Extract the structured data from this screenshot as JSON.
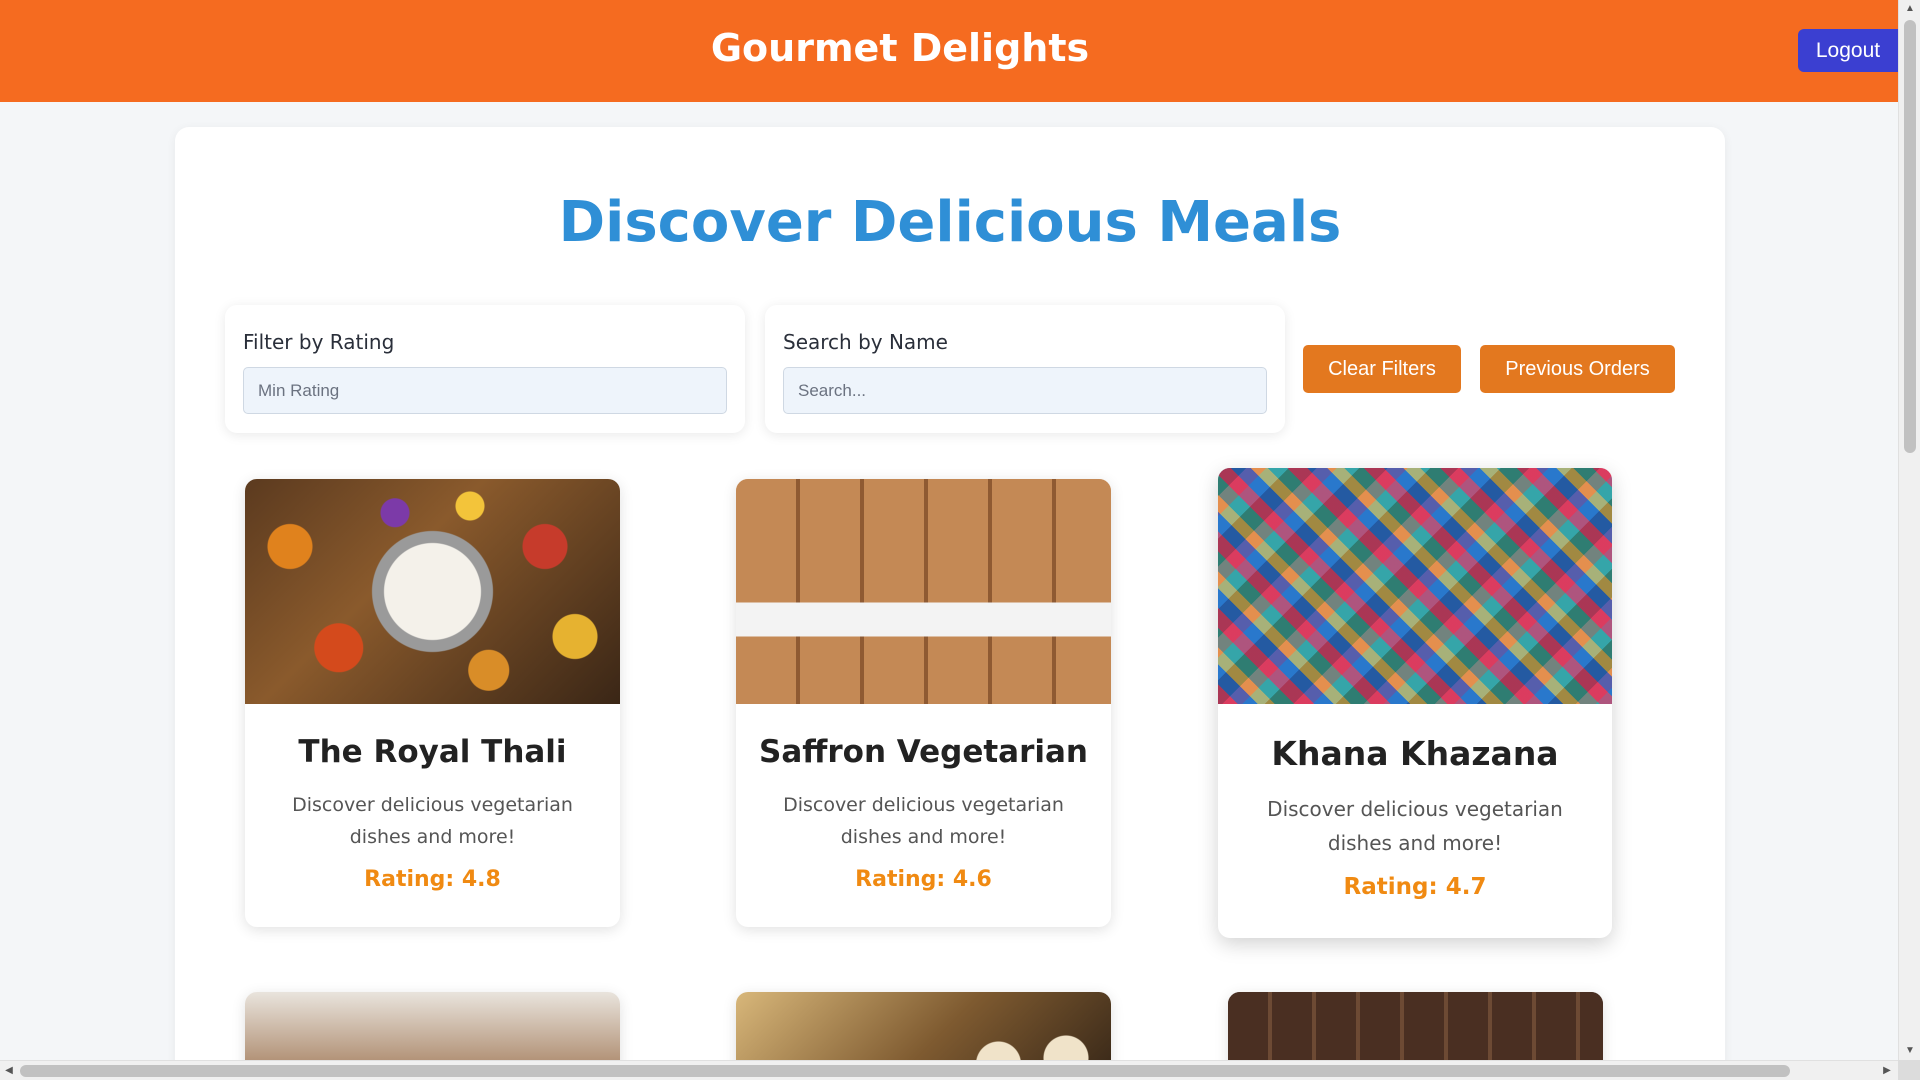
{
  "header": {
    "brand": "Gourmet Delights",
    "logout_label": "Logout",
    "bg_color": "#f56b20"
  },
  "main": {
    "title": "Discover Delicious Meals",
    "filters": {
      "rating_label": "Filter by Rating",
      "rating_placeholder": "Min Rating",
      "search_label": "Search by Name",
      "search_placeholder": "Search..."
    },
    "buttons": {
      "clear_filters": "Clear Filters",
      "previous_orders": "Previous Orders"
    },
    "meals": [
      {
        "name": "The Royal Thali",
        "description": "Discover delicious vegetarian dishes and more!",
        "rating": "Rating: 4.8"
      },
      {
        "name": "Saffron Vegetarian",
        "description": "Discover delicious vegetarian dishes and more!",
        "rating": "Rating: 4.6"
      },
      {
        "name": "Khana Khazana",
        "description": "Discover delicious vegetarian dishes and more!",
        "rating": "Rating: 4.7"
      }
    ]
  }
}
